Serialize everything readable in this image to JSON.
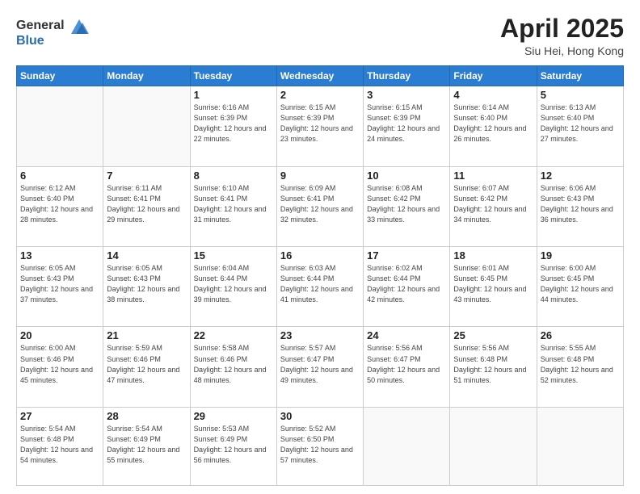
{
  "header": {
    "logo_general": "General",
    "logo_blue": "Blue",
    "title": "April 2025",
    "location": "Siu Hei, Hong Kong"
  },
  "weekdays": [
    "Sunday",
    "Monday",
    "Tuesday",
    "Wednesday",
    "Thursday",
    "Friday",
    "Saturday"
  ],
  "weeks": [
    [
      {
        "num": "",
        "info": ""
      },
      {
        "num": "",
        "info": ""
      },
      {
        "num": "1",
        "info": "Sunrise: 6:16 AM\nSunset: 6:39 PM\nDaylight: 12 hours and 22 minutes."
      },
      {
        "num": "2",
        "info": "Sunrise: 6:15 AM\nSunset: 6:39 PM\nDaylight: 12 hours and 23 minutes."
      },
      {
        "num": "3",
        "info": "Sunrise: 6:15 AM\nSunset: 6:39 PM\nDaylight: 12 hours and 24 minutes."
      },
      {
        "num": "4",
        "info": "Sunrise: 6:14 AM\nSunset: 6:40 PM\nDaylight: 12 hours and 26 minutes."
      },
      {
        "num": "5",
        "info": "Sunrise: 6:13 AM\nSunset: 6:40 PM\nDaylight: 12 hours and 27 minutes."
      }
    ],
    [
      {
        "num": "6",
        "info": "Sunrise: 6:12 AM\nSunset: 6:40 PM\nDaylight: 12 hours and 28 minutes."
      },
      {
        "num": "7",
        "info": "Sunrise: 6:11 AM\nSunset: 6:41 PM\nDaylight: 12 hours and 29 minutes."
      },
      {
        "num": "8",
        "info": "Sunrise: 6:10 AM\nSunset: 6:41 PM\nDaylight: 12 hours and 31 minutes."
      },
      {
        "num": "9",
        "info": "Sunrise: 6:09 AM\nSunset: 6:41 PM\nDaylight: 12 hours and 32 minutes."
      },
      {
        "num": "10",
        "info": "Sunrise: 6:08 AM\nSunset: 6:42 PM\nDaylight: 12 hours and 33 minutes."
      },
      {
        "num": "11",
        "info": "Sunrise: 6:07 AM\nSunset: 6:42 PM\nDaylight: 12 hours and 34 minutes."
      },
      {
        "num": "12",
        "info": "Sunrise: 6:06 AM\nSunset: 6:43 PM\nDaylight: 12 hours and 36 minutes."
      }
    ],
    [
      {
        "num": "13",
        "info": "Sunrise: 6:05 AM\nSunset: 6:43 PM\nDaylight: 12 hours and 37 minutes."
      },
      {
        "num": "14",
        "info": "Sunrise: 6:05 AM\nSunset: 6:43 PM\nDaylight: 12 hours and 38 minutes."
      },
      {
        "num": "15",
        "info": "Sunrise: 6:04 AM\nSunset: 6:44 PM\nDaylight: 12 hours and 39 minutes."
      },
      {
        "num": "16",
        "info": "Sunrise: 6:03 AM\nSunset: 6:44 PM\nDaylight: 12 hours and 41 minutes."
      },
      {
        "num": "17",
        "info": "Sunrise: 6:02 AM\nSunset: 6:44 PM\nDaylight: 12 hours and 42 minutes."
      },
      {
        "num": "18",
        "info": "Sunrise: 6:01 AM\nSunset: 6:45 PM\nDaylight: 12 hours and 43 minutes."
      },
      {
        "num": "19",
        "info": "Sunrise: 6:00 AM\nSunset: 6:45 PM\nDaylight: 12 hours and 44 minutes."
      }
    ],
    [
      {
        "num": "20",
        "info": "Sunrise: 6:00 AM\nSunset: 6:46 PM\nDaylight: 12 hours and 45 minutes."
      },
      {
        "num": "21",
        "info": "Sunrise: 5:59 AM\nSunset: 6:46 PM\nDaylight: 12 hours and 47 minutes."
      },
      {
        "num": "22",
        "info": "Sunrise: 5:58 AM\nSunset: 6:46 PM\nDaylight: 12 hours and 48 minutes."
      },
      {
        "num": "23",
        "info": "Sunrise: 5:57 AM\nSunset: 6:47 PM\nDaylight: 12 hours and 49 minutes."
      },
      {
        "num": "24",
        "info": "Sunrise: 5:56 AM\nSunset: 6:47 PM\nDaylight: 12 hours and 50 minutes."
      },
      {
        "num": "25",
        "info": "Sunrise: 5:56 AM\nSunset: 6:48 PM\nDaylight: 12 hours and 51 minutes."
      },
      {
        "num": "26",
        "info": "Sunrise: 5:55 AM\nSunset: 6:48 PM\nDaylight: 12 hours and 52 minutes."
      }
    ],
    [
      {
        "num": "27",
        "info": "Sunrise: 5:54 AM\nSunset: 6:48 PM\nDaylight: 12 hours and 54 minutes."
      },
      {
        "num": "28",
        "info": "Sunrise: 5:54 AM\nSunset: 6:49 PM\nDaylight: 12 hours and 55 minutes."
      },
      {
        "num": "29",
        "info": "Sunrise: 5:53 AM\nSunset: 6:49 PM\nDaylight: 12 hours and 56 minutes."
      },
      {
        "num": "30",
        "info": "Sunrise: 5:52 AM\nSunset: 6:50 PM\nDaylight: 12 hours and 57 minutes."
      },
      {
        "num": "",
        "info": ""
      },
      {
        "num": "",
        "info": ""
      },
      {
        "num": "",
        "info": ""
      }
    ]
  ]
}
